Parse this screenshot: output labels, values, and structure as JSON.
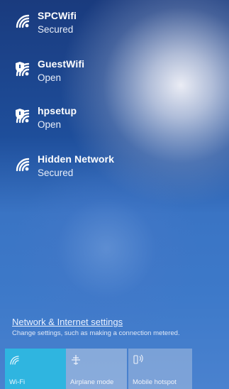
{
  "networks": [
    {
      "name": "SPCWifi",
      "status": "Secured",
      "icon": "wifi-signal-icon",
      "shield": false
    },
    {
      "name": "GuestWifi",
      "status": "Open",
      "icon": "wifi-signal-shield-icon",
      "shield": true
    },
    {
      "name": "hpsetup",
      "status": "Open",
      "icon": "wifi-signal-shield-icon",
      "shield": true
    },
    {
      "name": "Hidden Network",
      "status": "Secured",
      "icon": "wifi-signal-icon",
      "shield": false
    }
  ],
  "settings": {
    "link": "Network & Internet settings",
    "description": "Change settings, such as making a connection metered."
  },
  "quick_actions": {
    "wifi": {
      "label": "Wi-Fi",
      "icon": "wifi-icon",
      "active": true
    },
    "airplane": {
      "label": "Airplane mode",
      "icon": "airplane-icon",
      "active": false
    },
    "hotspot": {
      "label": "Mobile hotspot",
      "icon": "hotspot-icon",
      "active": false
    }
  },
  "colors": {
    "active_tile": "#2fb5e0",
    "background": "#1e4e9b"
  }
}
